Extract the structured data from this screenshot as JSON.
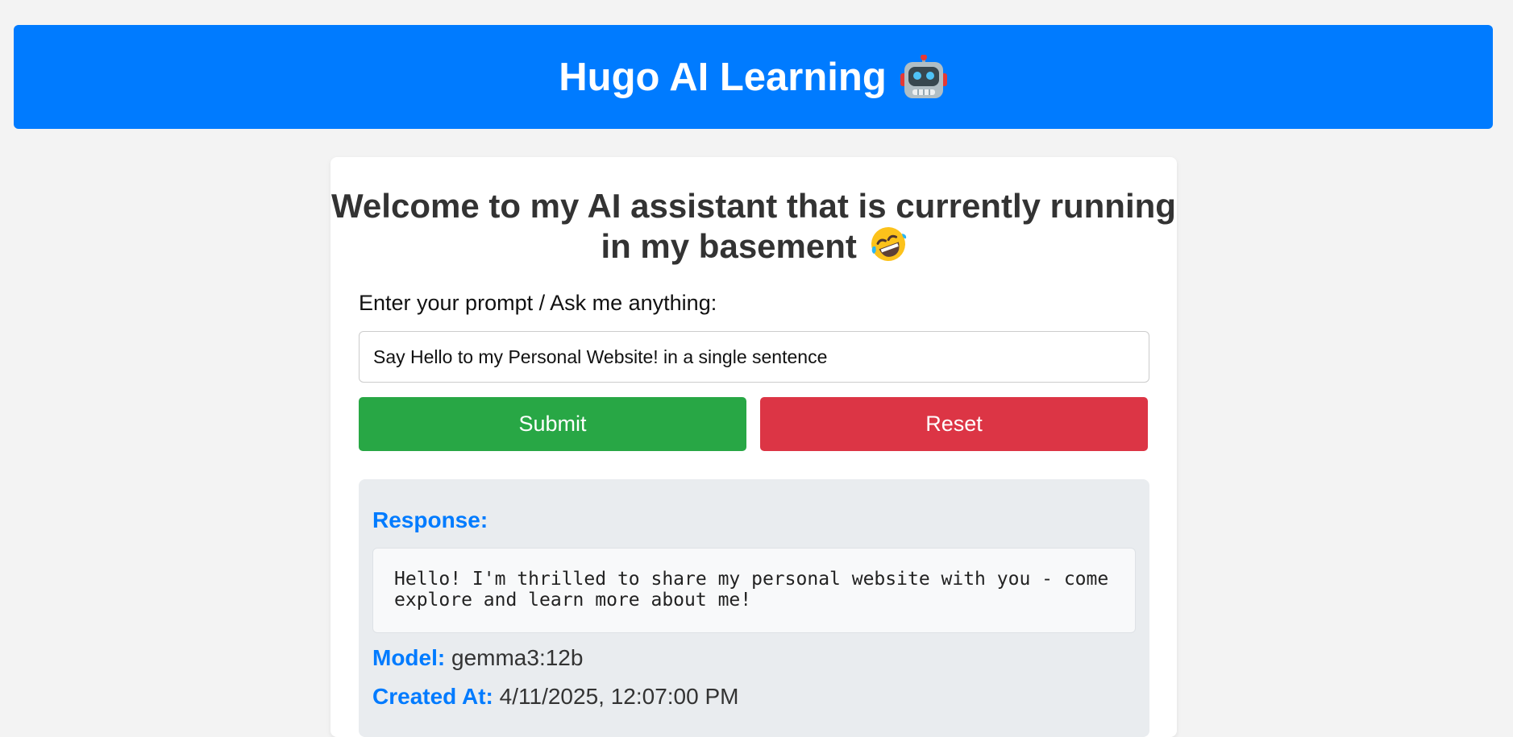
{
  "header": {
    "title": "Hugo AI Learning",
    "icon": "robot-icon"
  },
  "main": {
    "welcome_text": "Welcome to my AI assistant that is currently running in my basement",
    "welcome_icon": "rolling-laughing-emoji-icon",
    "prompt_label": "Enter your prompt / Ask me anything:",
    "prompt_value": "Say Hello to my Personal Website! in a single sentence",
    "submit_label": "Submit",
    "reset_label": "Reset"
  },
  "response": {
    "heading": "Response:",
    "text": "Hello! I'm thrilled to share my personal website with you - come explore and learn more about me!",
    "model_label": "Model:",
    "model_value": "gemma3:12b",
    "created_label": "Created At:",
    "created_value": "4/11/2025, 12:07:00 PM"
  },
  "colors": {
    "header_bg": "#007bff",
    "submit_bg": "#28a745",
    "reset_bg": "#dc3545",
    "accent_text": "#007bff",
    "page_bg": "#f3f3f3"
  }
}
